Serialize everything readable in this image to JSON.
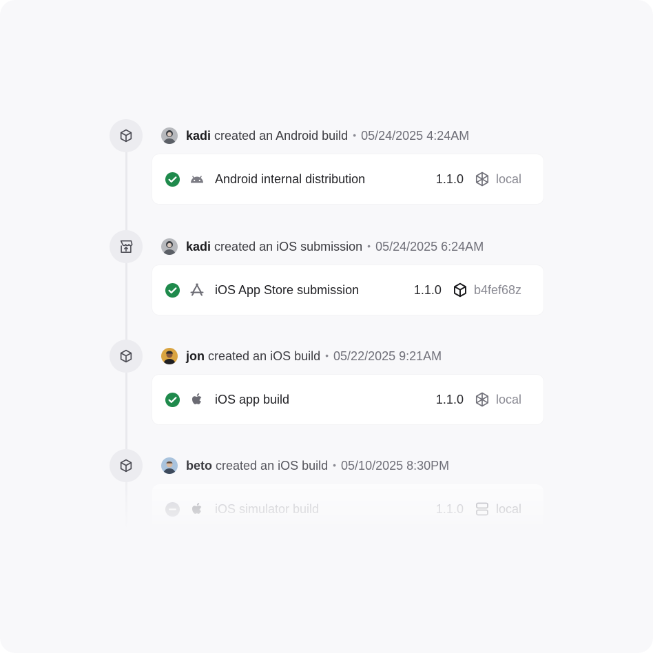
{
  "timeline": {
    "entries": [
      {
        "event_icon": "cube-icon",
        "avatar": "avatar-kadi",
        "user": "kadi",
        "action": "created an Android build",
        "separator": "•",
        "timestamp": "05/24/2025 4:24AM",
        "card": {
          "status_icon": "check-circle-icon",
          "platform_icon": "android-icon",
          "title": "Android internal distribution",
          "version": "1.1.0",
          "meta_icon": "expo-icon",
          "meta_label": "local"
        }
      },
      {
        "event_icon": "store-upload-icon",
        "avatar": "avatar-kadi",
        "user": "kadi",
        "action": "created an iOS submission",
        "separator": "•",
        "timestamp": "05/24/2025 6:24AM",
        "card": {
          "status_icon": "check-circle-icon",
          "platform_icon": "app-store-icon",
          "title": "iOS App Store submission",
          "version": "1.1.0",
          "meta_icon": "cube-icon",
          "meta_label": "b4fef68z"
        }
      },
      {
        "event_icon": "cube-icon",
        "avatar": "avatar-jon",
        "user": "jon",
        "action": "created an iOS build",
        "separator": "•",
        "timestamp": "05/22/2025 9:21AM",
        "card": {
          "status_icon": "check-circle-icon",
          "platform_icon": "apple-icon",
          "title": "iOS app build",
          "version": "1.1.0",
          "meta_icon": "expo-icon",
          "meta_label": "local"
        }
      },
      {
        "event_icon": "cube-icon",
        "avatar": "avatar-beto",
        "user": "beto",
        "action": "created an iOS build",
        "separator": "•",
        "timestamp": "05/10/2025 8:30PM",
        "card": {
          "status_icon": "cancel-circle-icon",
          "platform_icon": "apple-icon",
          "title": "iOS simulator build",
          "version": "1.1.0",
          "meta_icon": "server-icon",
          "meta_label": "local"
        }
      }
    ]
  },
  "colors": {
    "background": "#f8f8fa",
    "card": "#ffffff",
    "success": "#1f8a4c",
    "muted_text": "#8a8a93",
    "icon_bubble": "#ececf0"
  }
}
